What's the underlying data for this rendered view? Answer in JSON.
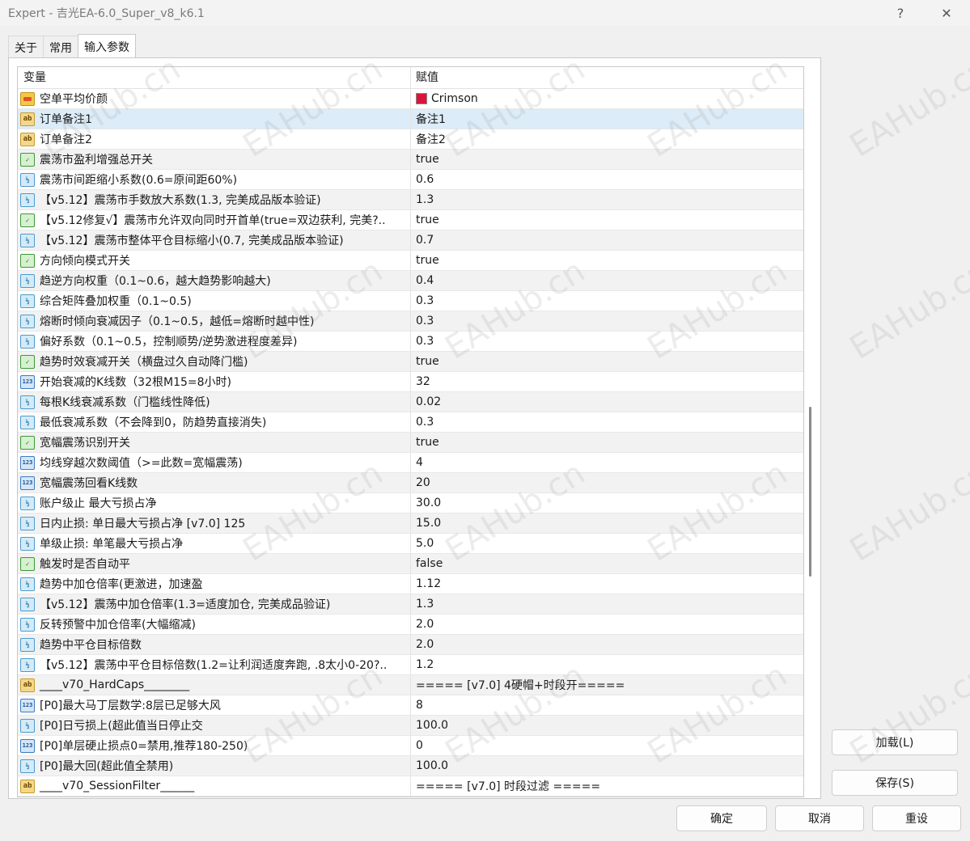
{
  "window": {
    "title": "Expert - 吉光EA-6.0_Super_v8_k6.1",
    "help_label": "?",
    "close_label": "✕"
  },
  "tabs": [
    {
      "label": "关于"
    },
    {
      "label": "常用"
    },
    {
      "label": "输入参数"
    }
  ],
  "grid": {
    "col_variable": "变量",
    "col_value": "赋值",
    "rows": [
      {
        "type": "color",
        "name": "空单平均价颜",
        "value": "Crimson",
        "swatch": "#dc143c"
      },
      {
        "type": "ab",
        "name": "订单备注1",
        "value": "备注1"
      },
      {
        "type": "ab",
        "name": "订单备注2",
        "value": "备注2"
      },
      {
        "type": "bool",
        "name": "震荡市盈利增强总开关",
        "value": "true"
      },
      {
        "type": "dbl",
        "name": "震荡市间距缩小系数(0.6=原间距60%)",
        "value": "0.6"
      },
      {
        "type": "dbl",
        "name": "【v5.12】震荡市手数放大系数(1.3, 完美成品版本验证)",
        "value": "1.3"
      },
      {
        "type": "bool",
        "name": "【v5.12修复√】震荡市允许双向同时开首单(true=双边获利, 完美?..",
        "value": "true"
      },
      {
        "type": "dbl",
        "name": "【v5.12】震荡市整体平仓目标缩小(0.7, 完美成品版本验证)",
        "value": "0.7"
      },
      {
        "type": "bool",
        "name": "方向倾向模式开关",
        "value": "true"
      },
      {
        "type": "dbl",
        "name": "趋逆方向权重（0.1~0.6，越大趋势影响越大)",
        "value": "0.4"
      },
      {
        "type": "dbl",
        "name": "综合矩阵叠加权重（0.1~0.5)",
        "value": "0.3"
      },
      {
        "type": "dbl",
        "name": "熔断时倾向衰减因子（0.1~0.5，越低=熔断时越中性)",
        "value": "0.3"
      },
      {
        "type": "dbl",
        "name": "偏好系数（0.1~0.5，控制顺势/逆势激进程度差异)",
        "value": "0.3"
      },
      {
        "type": "bool",
        "name": "趋势时效衰减开关（横盘过久自动降门槛)",
        "value": "true"
      },
      {
        "type": "int",
        "name": "开始衰减的K线数（32根M15=8小时)",
        "value": "32"
      },
      {
        "type": "dbl",
        "name": "每根K线衰减系数（门槛线性降低)",
        "value": "0.02"
      },
      {
        "type": "dbl",
        "name": "最低衰减系数（不会降到0，防趋势直接消失)",
        "value": "0.3"
      },
      {
        "type": "bool",
        "name": "宽幅震荡识别开关",
        "value": "true"
      },
      {
        "type": "int",
        "name": "均线穿越次数阈值（>=此数=宽幅震荡)",
        "value": "4"
      },
      {
        "type": "int",
        "name": "宽幅震荡回看K线数",
        "value": "20"
      },
      {
        "type": "dbl",
        "name": "账户级止 最大亏损占净",
        "value": "30.0"
      },
      {
        "type": "dbl",
        "name": "日内止损: 单日最大亏损占净 [v7.0] 125",
        "value": "15.0"
      },
      {
        "type": "dbl",
        "name": "单级止损: 单笔最大亏损占净",
        "value": "5.0"
      },
      {
        "type": "bool",
        "name": "触发时是否自动平",
        "value": "false"
      },
      {
        "type": "dbl",
        "name": "趋势中加仓倍率(更激进，加速盈",
        "value": "1.12"
      },
      {
        "type": "dbl",
        "name": "【v5.12】震荡中加仓倍率(1.3=适度加仓, 完美成品验证)",
        "value": "1.3"
      },
      {
        "type": "dbl",
        "name": "反转预警中加仓倍率(大幅缩减)",
        "value": "2.0"
      },
      {
        "type": "dbl",
        "name": "趋势中平仓目标倍数",
        "value": "2.0"
      },
      {
        "type": "dbl",
        "name": "【v5.12】震荡中平仓目标倍数(1.2=让利润适度奔跑, .8太小0-20?..",
        "value": "1.2"
      },
      {
        "type": "ab",
        "name": "____v70_HardCaps________",
        "value": "===== [v7.0] 4硬帽+时段开====="
      },
      {
        "type": "int",
        "name": "[P0]最大马丁层数学:8层已足够大风",
        "value": "8"
      },
      {
        "type": "dbl",
        "name": "[P0]日亏损上(超此值当日停止交",
        "value": "100.0"
      },
      {
        "type": "int",
        "name": "[P0]单层硬止损点0=禁用,推荐180-250)",
        "value": "0"
      },
      {
        "type": "dbl",
        "name": "[P0]最大回(超此值全禁用)",
        "value": "100.0"
      },
      {
        "type": "ab",
        "name": "____v70_SessionFilter______",
        "value": "===== [v7.0] 时段过滤 ====="
      }
    ]
  },
  "side_buttons": {
    "load": "加载(L)",
    "save": "保存(S)"
  },
  "footer_buttons": {
    "ok": "确定",
    "cancel": "取消",
    "reset": "重设"
  },
  "watermark_text": "EAHub.cn",
  "icon_glyphs": {
    "ab": "ab",
    "bool": "✓",
    "dbl": "½",
    "int": "123",
    "color": ""
  }
}
